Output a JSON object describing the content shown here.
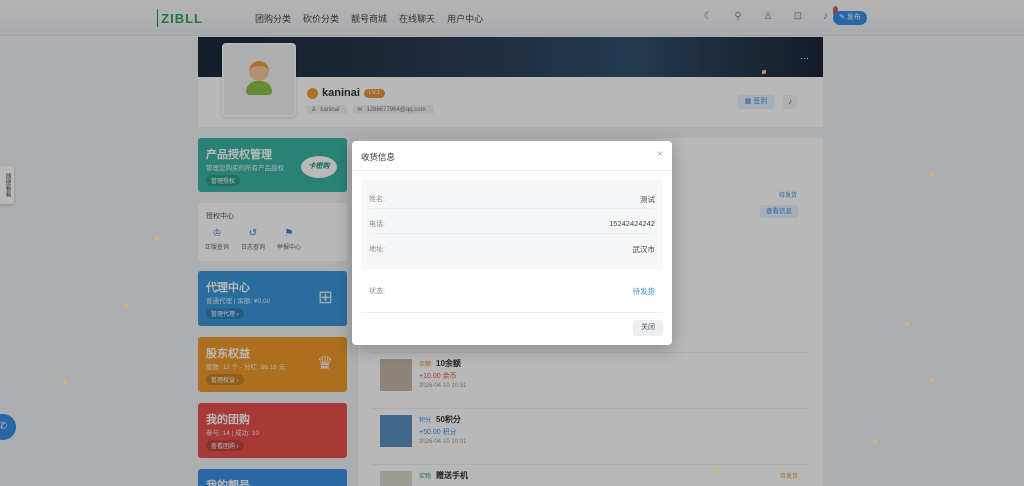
{
  "brand": {
    "logo_text": "ZIBLL"
  },
  "nav": [
    "团购分类",
    "砍价分类",
    "靓号商城",
    "在线聊天",
    "用户中心"
  ],
  "top_icons": [
    "moon-icon",
    "search-icon",
    "user-icon",
    "cart-icon",
    "bell-icon"
  ],
  "notification_count": "5",
  "publish_label": "发布",
  "profile": {
    "username": "kaninai",
    "level": "LV.1",
    "handle": "kaninai",
    "email": "1286677964@qq.com",
    "sign_label": "签到",
    "bell_count": "1"
  },
  "sidebar": {
    "license": {
      "title": "产品授权管理",
      "sub": "管理您购买的所有产品授权",
      "button": "管理授权",
      "badge": "卡密购"
    },
    "auth_center": {
      "title": "授权中心",
      "items": [
        "正版查询",
        "日志查询",
        "举报中心"
      ]
    },
    "agent": {
      "title": "代理中心",
      "sub": "普通代理 | 余额: ¥0.00",
      "button": "管理代理"
    },
    "shareholder": {
      "title": "股东权益",
      "sub": "股数: 12 个 · 分红: 86.16 元",
      "button": "管理权益"
    },
    "group": {
      "title": "我的团购",
      "sub": "参与: 14 | 成功: 10",
      "button": "查看团购"
    },
    "account": {
      "title": "我的靓号"
    }
  },
  "float_tab": "随便看看",
  "orders": [
    {
      "tag": "余额",
      "name": "10余额",
      "amount": "+10.00 余币",
      "time": "2026-04-10 10:51",
      "status": ""
    },
    {
      "tag": "积分",
      "name": "50积分",
      "amount": "+50.00 积分",
      "time": "2026-04-10 10:01",
      "status": ""
    },
    {
      "tag": "实物",
      "name": "赠送手机",
      "amount": "",
      "time": "",
      "status": "待发货"
    }
  ],
  "side_status": "待发货",
  "view_info_label": "查看信息",
  "modal": {
    "title": "收货信息",
    "close_icon": "×",
    "fields": [
      {
        "label": "姓名:",
        "value": "测试"
      },
      {
        "label": "电话:",
        "value": "15242424242"
      },
      {
        "label": "地址:",
        "value": "武汉市"
      }
    ],
    "status_label": "状态:",
    "status_value": "待发货",
    "close_button": "关闭"
  }
}
